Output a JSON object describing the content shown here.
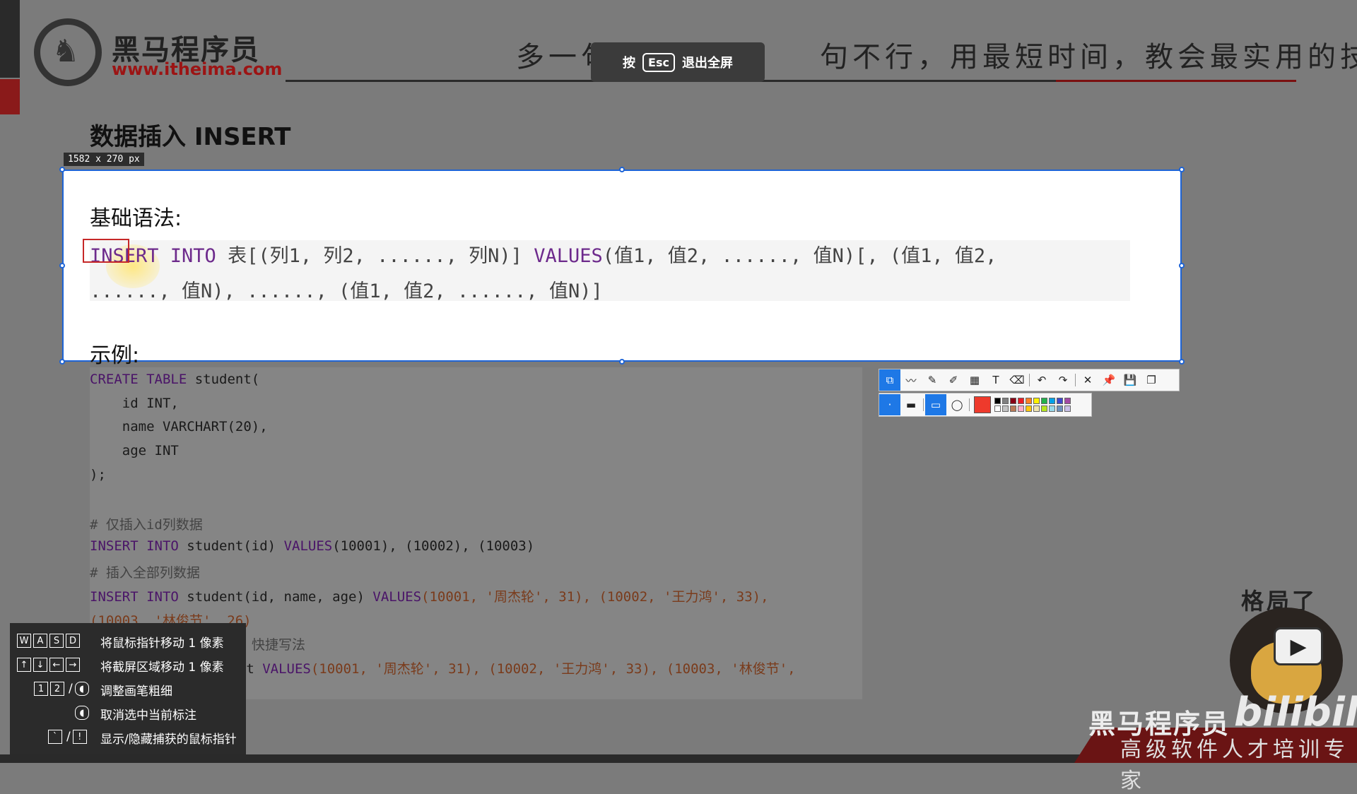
{
  "header": {
    "brand_cn": "黑马程序员",
    "brand_url": "www.itheima.com",
    "slogan_left": "多一句没有",
    "slogan_right": "句不行，用最短时间，教会最实用的技术!",
    "esc_prefix": "按",
    "esc_key": "Esc",
    "esc_suffix": "退出全屏"
  },
  "slide": {
    "title": "数据插入 INSERT",
    "basic_syntax_label": "基础语法:",
    "example_label": "示例:"
  },
  "capture": {
    "size_label": "1582 x 270  px"
  },
  "syntax": {
    "line1_kw1": "INSERT INTO",
    "line1_rest1": " 表[(列1, 列2, ......, 列N)] ",
    "line1_kw2": "VALUES",
    "line1_rest2": "(值1, 值2, ......, 值N)[, (值1, 值2,",
    "line2": "......, 值N), ......, (值1, 值2, ......, 值N)]"
  },
  "code": {
    "create_kw": "CREATE TABLE",
    "create_rest": " student(",
    "l2": "    id INT,",
    "l3": "    name VARCHART(20),",
    "l4": "    age INT",
    "l5": ");",
    "c1": "# 仅插入id列数据",
    "i1_kw": "INSERT INTO",
    "i1_mid": " student(id) ",
    "i1_kw2": "VALUES",
    "i1_rest": "(10001), (10002), (10003)",
    "c2": "# 插入全部列数据",
    "i2_kw": "INSERT INTO",
    "i2_mid": " student(id, name, age) ",
    "i2_kw2": "VALUES",
    "i2_rest": "(10001, '周杰轮', 31), (10002, '王力鸿', 33),",
    "i2_cont": "(10003, '林俊节', 26)",
    "c3": "快捷写法",
    "i3_mid": "dent ",
    "i3_kw2": "VALUES",
    "i3_rest": "(10001, '周杰轮', 31), (10002, '王力鸿', 33), (10003, '林俊节',"
  },
  "toolbar": {
    "row1_icons": [
      "rect-select-icon",
      "line-icon",
      "pen-icon",
      "marker-icon",
      "mosaic-icon",
      "text-icon",
      "eraser-icon",
      "undo-icon",
      "redo-icon",
      "close-icon",
      "pin-icon",
      "save-icon",
      "copy-icon"
    ],
    "row1_glyphs": [
      "⧉",
      "〰",
      "✎",
      "✐",
      "▦",
      "T",
      "⌫",
      "↶",
      "↷",
      "✕",
      "📌",
      "💾",
      "❐"
    ],
    "colors": [
      "#000000",
      "#7f7f7f",
      "#880015",
      "#ed1c24",
      "#ff7f27",
      "#fff200",
      "#22b14c",
      "#00a2e8",
      "#3f48cc",
      "#a349a4",
      "#ffffff",
      "#c3c3c3",
      "#b97a57",
      "#ffaec9",
      "#ffc90e",
      "#efe4b0",
      "#b5e61d",
      "#99d9ea",
      "#7092be",
      "#c8bfe7"
    ],
    "current_color": "#ee3a2c"
  },
  "help": {
    "keys_wasd": [
      "W",
      "A",
      "S",
      "D"
    ],
    "wasd_text": "将鼠标指针移动 1 像素",
    "keys_arrows": [
      "↑",
      "↓",
      "←",
      "→"
    ],
    "arrows_text": "将截屏区域移动 1 像素",
    "keys_width": [
      "1",
      "2"
    ],
    "width_text": "调整画笔粗细",
    "deselect_text": "取消选中当前标注",
    "keys_toggle": [
      "`",
      "!"
    ],
    "toggle_text": "显示/隐藏捕获的鼠标指针",
    "slash": "/"
  },
  "watermark": {
    "gejuele": "格局了",
    "brand_cn": "黑马程序员",
    "bili": "bilibili",
    "subtitle": "高级软件人才培训专家"
  }
}
